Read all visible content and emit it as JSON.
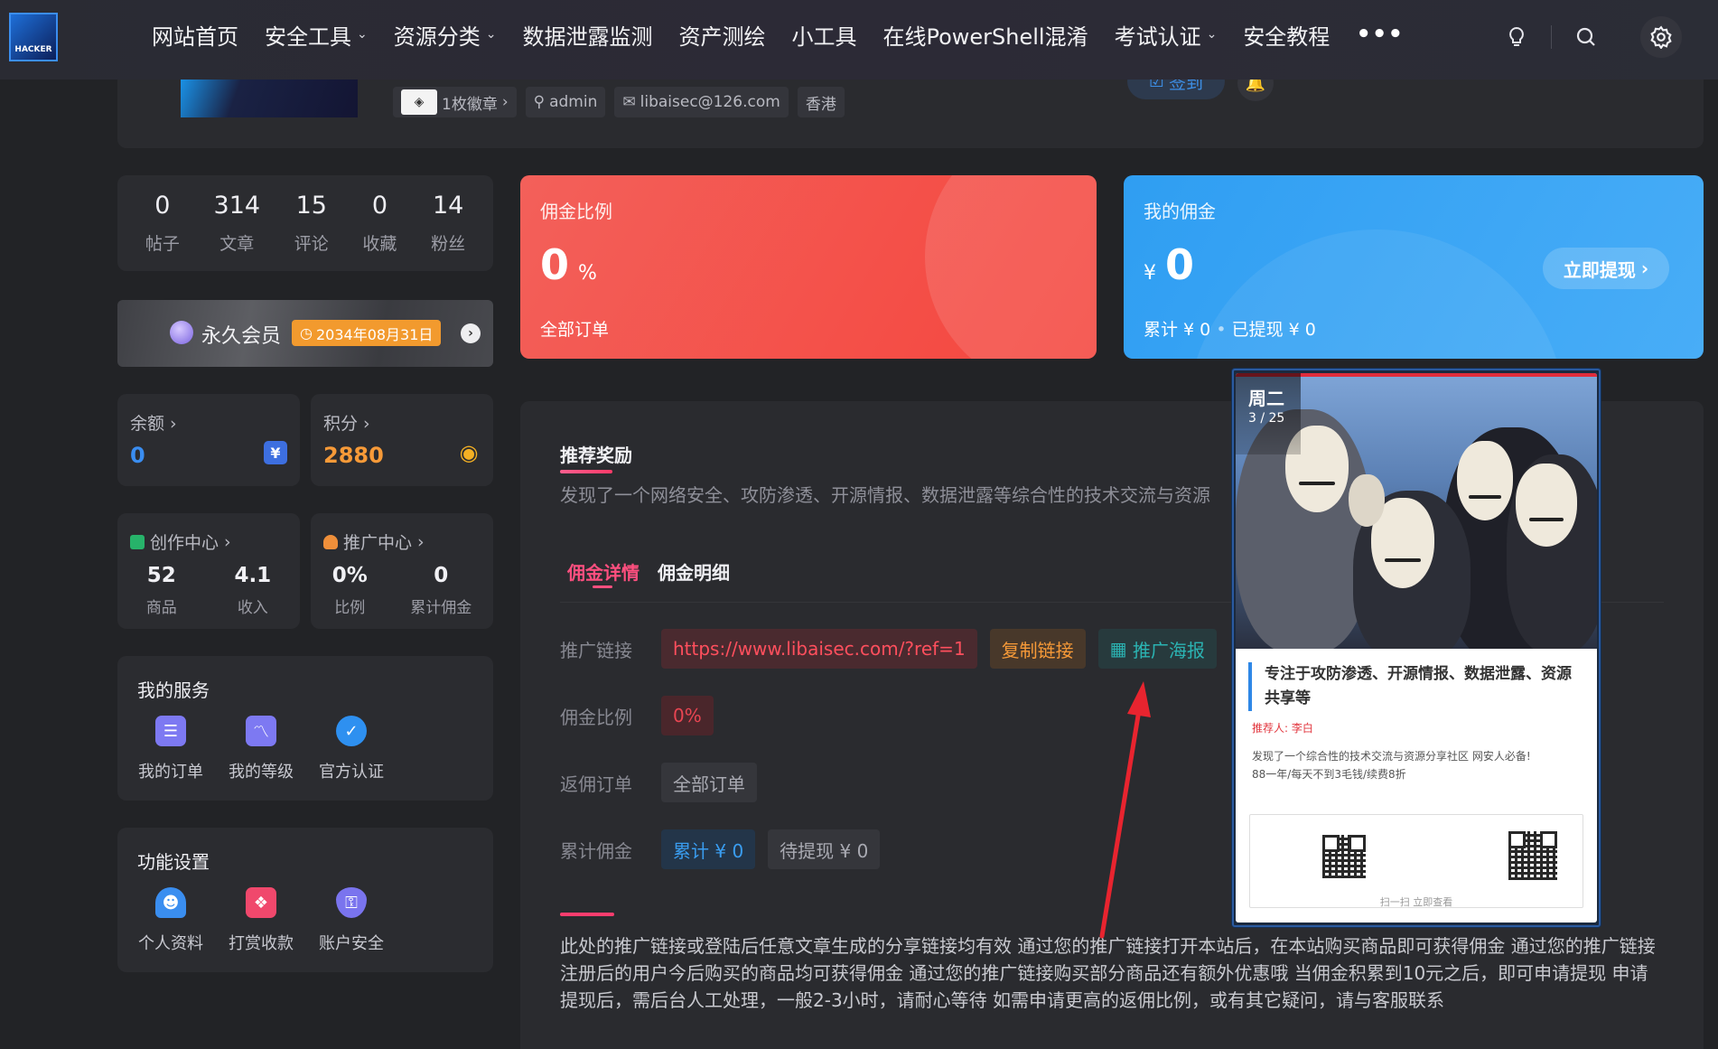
{
  "nav": {
    "logo_text": "HACKER",
    "items": [
      {
        "label": "网站首页",
        "dropdown": false
      },
      {
        "label": "安全工具",
        "dropdown": true
      },
      {
        "label": "资源分类",
        "dropdown": true
      },
      {
        "label": "数据泄露监测",
        "dropdown": false
      },
      {
        "label": "资产测绘",
        "dropdown": false
      },
      {
        "label": "小工具",
        "dropdown": false
      },
      {
        "label": "在线PowerShell混淆",
        "dropdown": false
      },
      {
        "label": "考试认证",
        "dropdown": true
      },
      {
        "label": "安全教程",
        "dropdown": false
      }
    ],
    "more": "•••",
    "icons": [
      "lightbulb-icon",
      "search-icon",
      "gear-icon"
    ]
  },
  "profile": {
    "badges": "1枚徽章",
    "username": "admin",
    "email": "libaisec@126.com",
    "location": "香港",
    "signin_label": "签到"
  },
  "stats": [
    {
      "num": "0",
      "label": "帖子"
    },
    {
      "num": "314",
      "label": "文章"
    },
    {
      "num": "15",
      "label": "评论"
    },
    {
      "num": "0",
      "label": "收藏"
    },
    {
      "num": "14",
      "label": "粉丝"
    }
  ],
  "vip": {
    "label": "永久会员",
    "expiry": "2034年08月31日"
  },
  "wallet": {
    "balance_label": "余额",
    "balance_value": "0",
    "points_label": "积分",
    "points_value": "2880"
  },
  "creator_center": {
    "title": "创作中心",
    "products_num": "52",
    "products_label": "商品",
    "income_num": "4.1",
    "income_label": "收入"
  },
  "promo_center": {
    "title": "推广中心",
    "ratio_num": "0%",
    "ratio_label": "比例",
    "total_num": "0",
    "total_label": "累计佣金"
  },
  "my_services": {
    "heading": "我的服务",
    "items": [
      {
        "label": "我的订单",
        "icon": "clipboard-icon"
      },
      {
        "label": "我的等级",
        "icon": "chart-icon"
      },
      {
        "label": "官方认证",
        "icon": "verified-icon"
      }
    ]
  },
  "settings": {
    "heading": "功能设置",
    "items": [
      {
        "label": "个人资料",
        "icon": "user-profile-icon"
      },
      {
        "label": "打赏收款",
        "icon": "gift-icon"
      },
      {
        "label": "账户安全",
        "icon": "shield-icon"
      }
    ]
  },
  "commission_rate_card": {
    "title": "佣金比例",
    "value": "0",
    "unit": "%",
    "sub": "全部订单"
  },
  "my_commission_card": {
    "title": "我的佣金",
    "currency": "¥",
    "value": "0",
    "sub_total": "累计 ¥ 0",
    "sub_withdrawn": "已提现 ¥ 0",
    "withdraw_label": "立即提现"
  },
  "referral": {
    "heading": "推荐奖励",
    "description": "发现了一个网络安全、攻防渗透、开源情报、数据泄露等综合性的技术交流与资源",
    "tabs": [
      "佣金详情",
      "佣金明细"
    ],
    "rows": {
      "link_label": "推广链接",
      "link_value": "https://www.libaisec.com/?ref=1",
      "copy_label": "复制链接",
      "poster_label": "推广海报",
      "rate_label": "佣金比例",
      "rate_value": "0%",
      "order_label": "返佣订单",
      "order_value": "全部订单",
      "total_label": "累计佣金",
      "total_value": "累计 ¥ 0",
      "pending_value": "待提现 ¥ 0"
    },
    "footer": "此处的推广链接或登陆后任意文章生成的分享链接均有效 通过您的推广链接打开本站后，在本站购买商品即可获得佣金 通过您的推广链接注册后的用户今后购买的商品均可获得佣金 通过您的推广链接购买部分商品还有额外优惠哦 当佣金积累到10元之后，即可申请提现 申请提现后，需后台人工处理，一般2-3小时，请耐心等待 如需申请更高的返佣比例，或有其它疑问，请与客服联系"
  },
  "poster": {
    "day": "周二",
    "date": "3 / 25",
    "title": "专注于攻防渗透、开源情报、数据泄露、资源共享等",
    "referrer": "推荐人: 李白",
    "desc_line1": "发现了一个综合性的技术交流与资源分享社区 网安人必备!",
    "desc_line2": "88一年/每天不到3毛钱/续费8折",
    "scan_text": "扫一扫 立即查看"
  },
  "colors": {
    "accent_pink": "#ff4f7f",
    "red_card": "#f4463e",
    "blue_card": "#2f9ef2",
    "points_orange": "#f79a38",
    "balance_blue": "#3a8df0"
  }
}
